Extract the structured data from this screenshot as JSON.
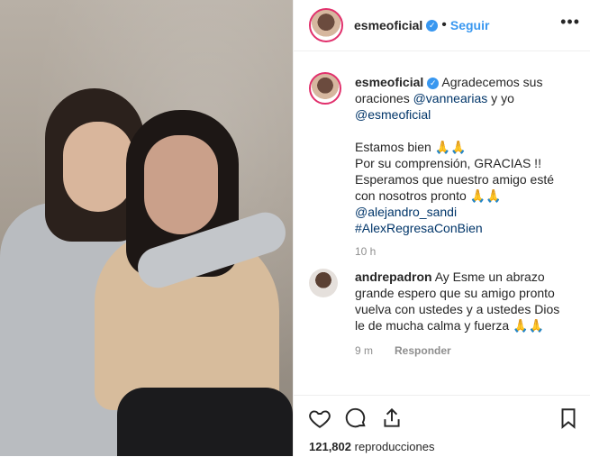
{
  "header": {
    "username": "esmeoficial",
    "separator": "•",
    "follow_label": "Seguir",
    "more_label": "•••"
  },
  "caption": {
    "username": "esmeoficial",
    "text_1": " Agradecemos sus oraciones ",
    "mention_1": "@vannearias",
    "text_2": " y yo ",
    "mention_2": "@esmeoficial",
    "line_1": "Estamos bien 🙏🙏",
    "line_2": "Por su comprensión, GRACIAS !!",
    "line_3": "Esperamos que nuestro amigo esté con nosotros pronto 🙏🙏",
    "mention_3": "@alejandro_sandi",
    "hashtag": "#AlexRegresaConBien",
    "time": "10 h"
  },
  "comment": {
    "username": "andrepadron",
    "text": " Ay Esme un abrazo grande espero que su amigo pronto vuelva con ustedes y a ustedes Dios le de mucha calma y fuerza 🙏🙏",
    "time": "9 m",
    "reply_label": "Responder"
  },
  "footer": {
    "views_count": "121,802",
    "views_label": " reproducciones"
  },
  "colors": {
    "link": "#3897f0",
    "mention": "#003569",
    "muted": "#8e8e8e",
    "text": "#262626"
  },
  "icons": [
    "heart-icon",
    "comment-icon",
    "share-icon",
    "bookmark-icon",
    "verified-badge-icon",
    "more-options-icon"
  ]
}
